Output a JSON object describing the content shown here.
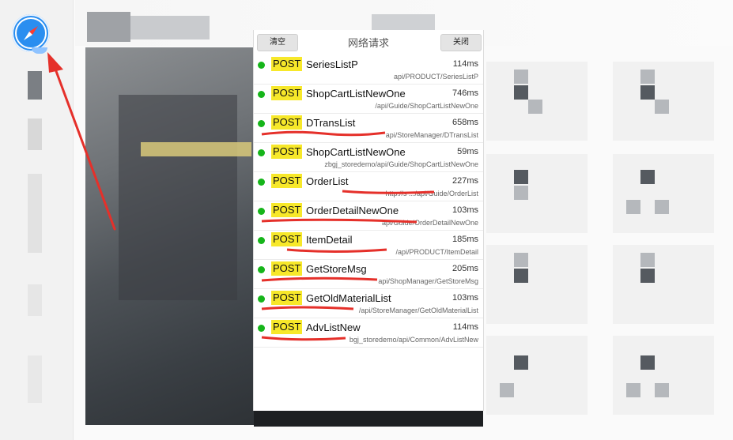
{
  "panel": {
    "title": "网络请求",
    "clear_label": "清空",
    "close_label": "关闭"
  },
  "requests": [
    {
      "method": "POST",
      "name": "SeriesListP",
      "time": "114ms",
      "url": "api/PRODUCT/SeriesListP"
    },
    {
      "method": "POST",
      "name": "ShopCartListNewOne",
      "time": "746ms",
      "url": "/api/Guide/ShopCartListNewOne"
    },
    {
      "method": "POST",
      "name": "DTransList",
      "time": "658ms",
      "url": "api/StoreManager/DTransList"
    },
    {
      "method": "POST",
      "name": "ShopCartListNewOne",
      "time": "59ms",
      "url": "zbgj_storedemo/api/Guide/ShopCartListNewOne"
    },
    {
      "method": "POST",
      "name": "OrderList",
      "time": "227ms",
      "url": "http://s  .../api/Guide/OrderList"
    },
    {
      "method": "POST",
      "name": "OrderDetailNewOne",
      "time": "103ms",
      "url": "api/Guide/OrderDetailNewOne"
    },
    {
      "method": "POST",
      "name": "ItemDetail",
      "time": "185ms",
      "url": "/api/PRODUCT/ItemDetail"
    },
    {
      "method": "POST",
      "name": "GetStoreMsg",
      "time": "205ms",
      "url": "api/ShopManager/GetStoreMsg"
    },
    {
      "method": "POST",
      "name": "GetOldMaterialList",
      "time": "103ms",
      "url": "/api/StoreManager/GetOldMaterialList"
    },
    {
      "method": "POST",
      "name": "AdvListNew",
      "time": "114ms",
      "url": "bgj_storedemo/api/Common/AdvListNew"
    }
  ],
  "colors": {
    "status_dot": "#16b51a",
    "method_bg": "#f7e82a",
    "annotation": "#e5302a",
    "compass": "#2a8ef0"
  },
  "icons": {
    "compass": "compass-icon"
  }
}
